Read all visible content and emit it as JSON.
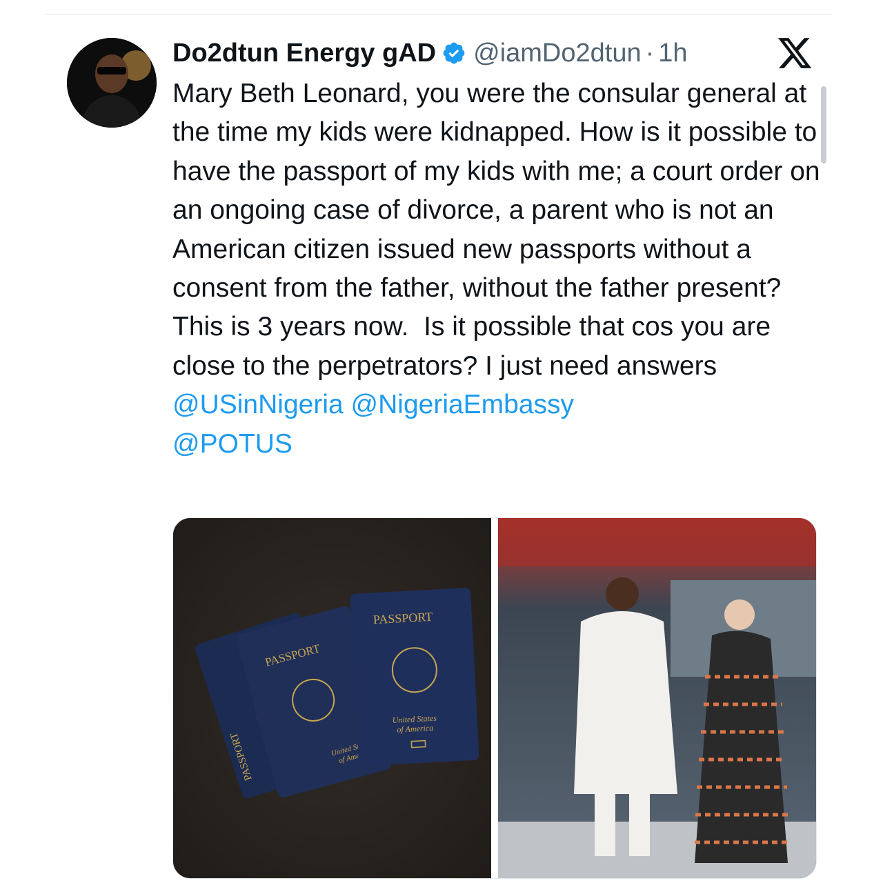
{
  "tweet": {
    "display_name": "Do2dtun Energy gAD",
    "handle": "@iamDo2dtun",
    "separator": "·",
    "time": "1h",
    "body_text": "Mary Beth Leonard, you were the consular general at the time my kids were kidnapped. How is it possible to have the passport of my kids with me; a court order on an ongoing case of divorce, a parent who is not an American citizen issued new passports without a consent from the father, without the father present? This is 3 years now.  Is it possible that cos you are close to the perpetrators? I just need answers ",
    "mentions": [
      "@USinNigeria",
      "@NigeriaEmbassy",
      "@POTUS"
    ],
    "media": {
      "photo_left": {
        "passport_labels": [
          "PASSPORT",
          "PASSPORT",
          "PASSPORT"
        ],
        "country_lines": [
          "United States",
          "of America"
        ]
      },
      "photo_right": {}
    }
  },
  "colors": {
    "mention": "#1d9bf0",
    "verified": "#1d9bf0",
    "secondary_text": "#536471"
  },
  "icons": {
    "verified": "verified-badge-icon",
    "platform": "x-logo-icon"
  }
}
